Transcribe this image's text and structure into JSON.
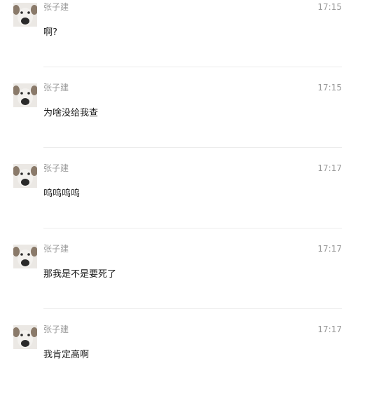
{
  "messages": [
    {
      "sender": "张子建",
      "time": "17:15",
      "text": "啊?",
      "avatar_icon": "dog-avatar-icon"
    },
    {
      "sender": "张子建",
      "time": "17:15",
      "text": "为啥没给我查",
      "avatar_icon": "dog-avatar-icon"
    },
    {
      "sender": "张子建",
      "time": "17:17",
      "text": "呜呜呜呜",
      "avatar_icon": "dog-avatar-icon"
    },
    {
      "sender": "张子建",
      "time": "17:17",
      "text": "那我是不是要死了",
      "avatar_icon": "dog-avatar-icon"
    },
    {
      "sender": "张子建",
      "time": "17:17",
      "text": "我肯定高啊",
      "avatar_icon": "dog-avatar-icon"
    }
  ]
}
